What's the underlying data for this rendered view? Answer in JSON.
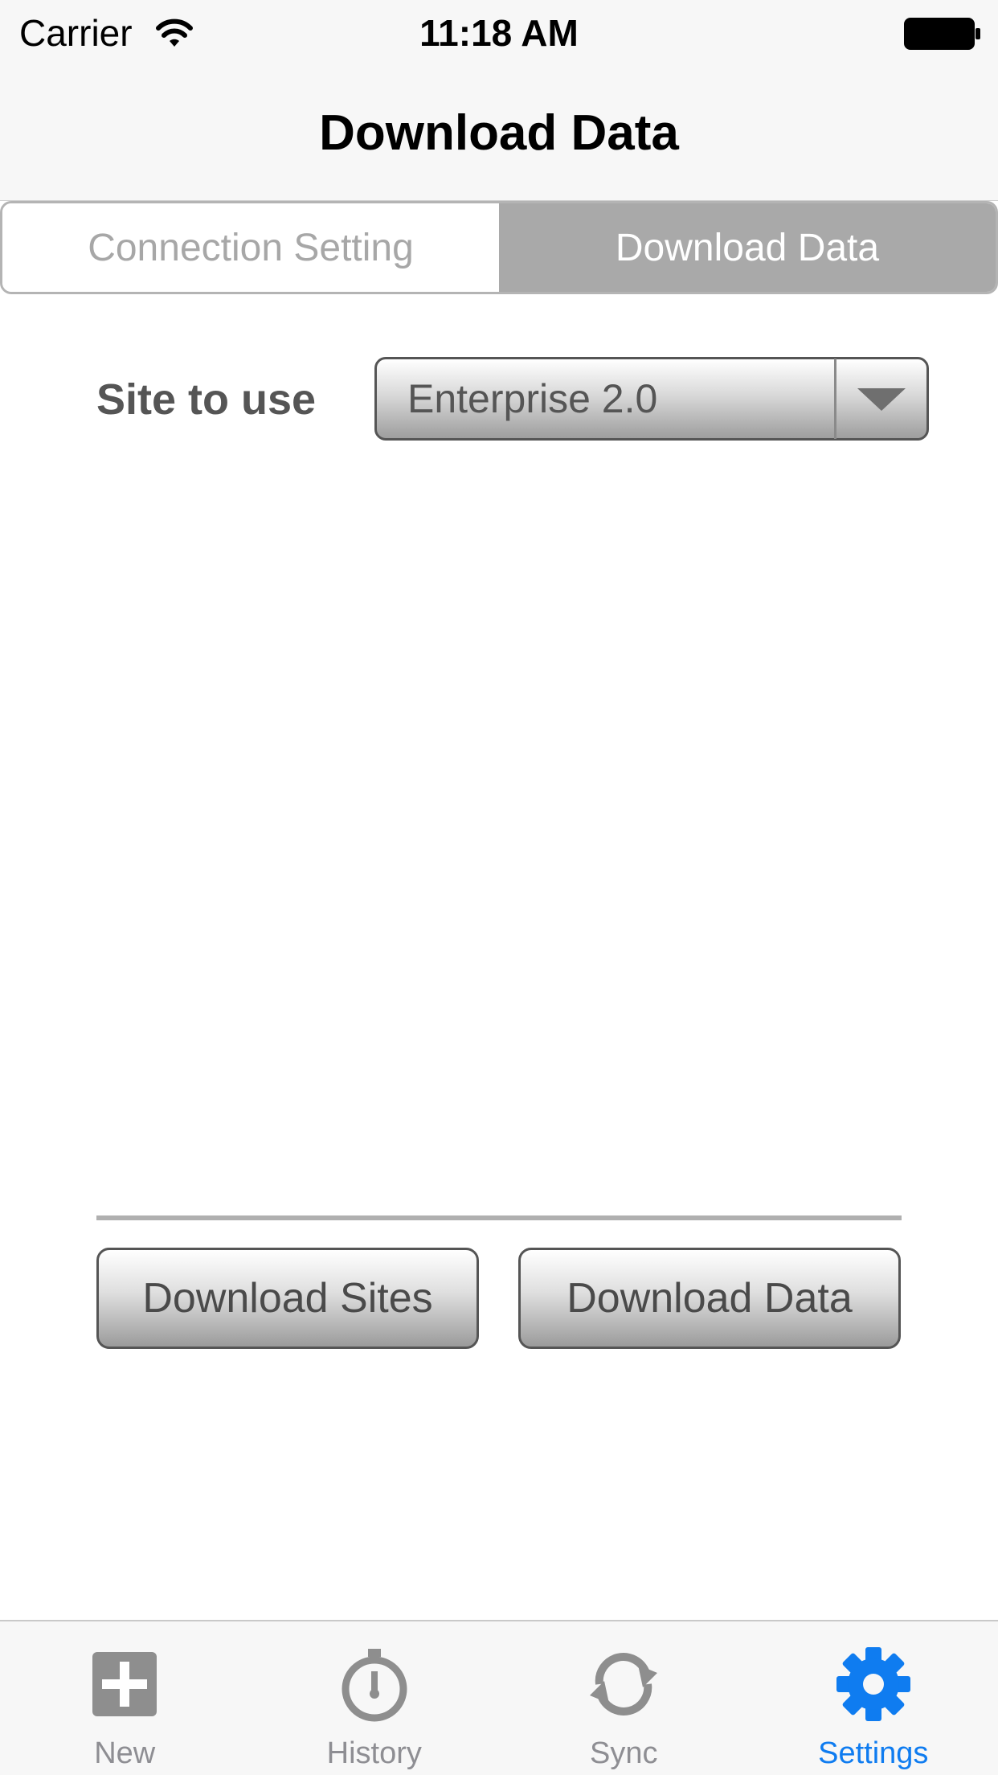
{
  "status_bar": {
    "carrier": "Carrier",
    "time": "11:18 AM",
    "wifi_icon": "wifi-icon",
    "battery_icon": "battery-icon"
  },
  "nav_bar": {
    "title": "Download Data"
  },
  "segmented_control": {
    "segments": [
      {
        "label": "Connection Setting",
        "selected": false
      },
      {
        "label": "Download Data",
        "selected": true
      }
    ]
  },
  "site_selector": {
    "label": "Site to use",
    "value": "Enterprise 2.0",
    "arrow_icon": "triangle-down-icon"
  },
  "actions": {
    "download_sites_label": "Download Sites",
    "download_data_label": "Download Data"
  },
  "tab_bar": {
    "items": [
      {
        "label": "New",
        "icon": "plus-square-icon",
        "active": false
      },
      {
        "label": "History",
        "icon": "stopwatch-icon",
        "active": false
      },
      {
        "label": "Sync",
        "icon": "sync-arrows-icon",
        "active": false
      },
      {
        "label": "Settings",
        "icon": "gear-icon",
        "active": true
      }
    ]
  },
  "colors": {
    "accent": "#0f7cf0",
    "tab_inactive": "#8e8e93",
    "segment_active": "#a9a9a9"
  }
}
